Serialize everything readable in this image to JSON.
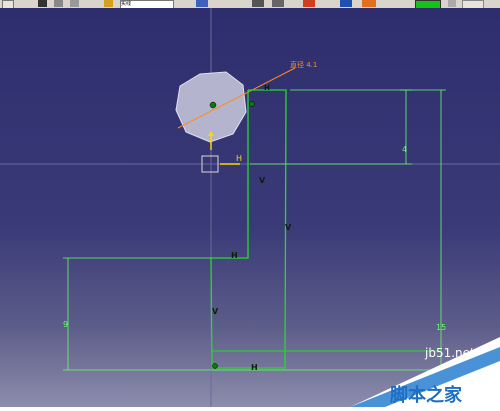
{
  "toolbar": {
    "icons": [
      "sketch-tool-icon",
      "open-icon",
      "save-icon",
      "print-icon",
      "pen-icon",
      "style-dropdown",
      "curve-icon",
      "zoom-icon",
      "fit-icon",
      "grid-icon",
      "constraint-icon",
      "analysis-icon",
      "color-swatch"
    ],
    "style_value": "实线",
    "accent_color": "#16c216"
  },
  "sketch": {
    "diameter_label": "直径 4.1",
    "axis_h": "H",
    "axis_v": "V",
    "dim_4": "4",
    "dim_9": "9",
    "dim_15": "15",
    "constraint_v": "V",
    "constraint_h": "H",
    "line_color": "#22dd22",
    "dimension_color": "#66ff66",
    "diameter_color": "#ff8c1a"
  },
  "watermark": {
    "url": "jb51.net",
    "site": "脚本之家"
  }
}
